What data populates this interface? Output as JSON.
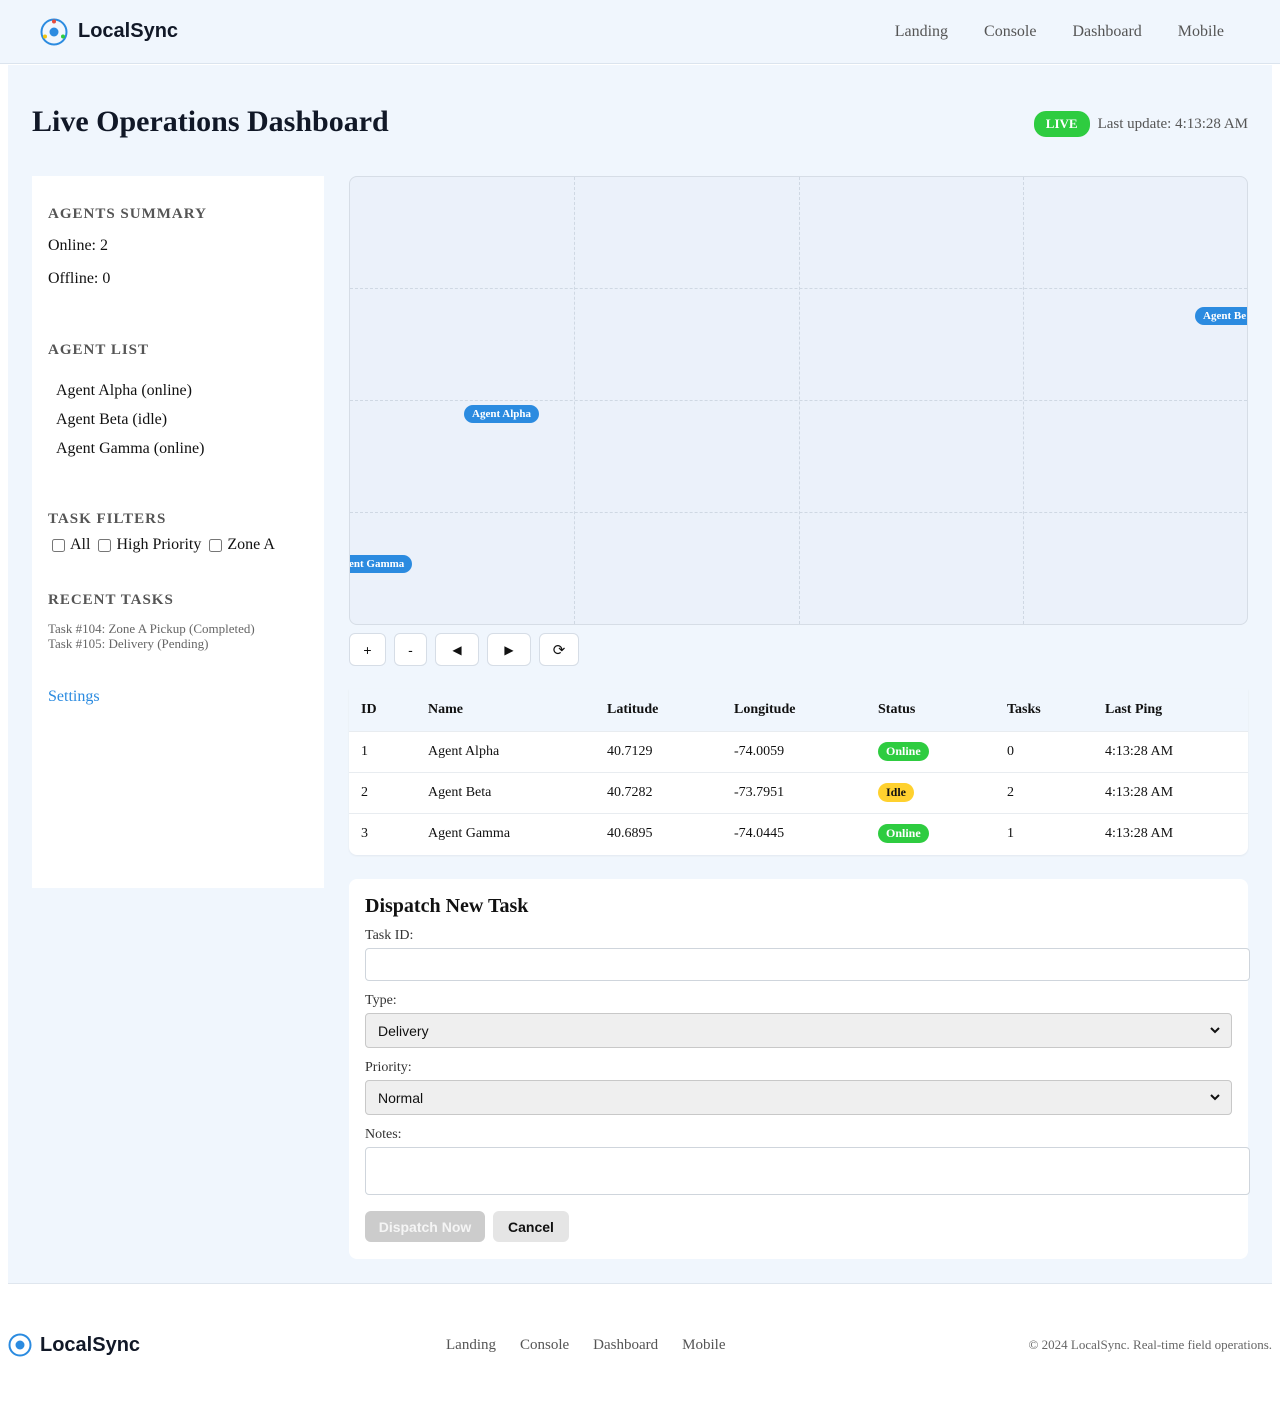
{
  "header": {
    "brand": "LocalSync",
    "nav": [
      "Landing",
      "Console",
      "Dashboard",
      "Mobile"
    ]
  },
  "page": {
    "title": "Live Operations Dashboard",
    "live_badge": "LIVE",
    "last_update": "Last update: 4:13:28 AM"
  },
  "sidebar": {
    "agents_summary_title": "AGENTS SUMMARY",
    "online": "Online: 2",
    "offline": "Offline: 0",
    "agent_list_title": "AGENT LIST",
    "agents": [
      "Agent Alpha (online)",
      "Agent Beta (idle)",
      "Agent Gamma (online)"
    ],
    "task_filters_title": "TASK FILTERS",
    "filters": [
      "All",
      "High Priority",
      "Zone A"
    ],
    "recent_tasks_title": "RECENT TASKS",
    "recent_tasks": [
      "Task #104: Zone A Pickup (Completed)",
      "Task #105: Delivery (Pending)"
    ],
    "settings": "Settings"
  },
  "map": {
    "markers": [
      "Agent Alpha",
      "Agent Be",
      "ent Gamma"
    ],
    "controls": [
      "+",
      "-",
      "◀",
      "▶",
      "⟳"
    ]
  },
  "table": {
    "headers": [
      "ID",
      "Name",
      "Latitude",
      "Longitude",
      "Status",
      "Tasks",
      "Last Ping"
    ],
    "rows": [
      [
        "1",
        "Agent Alpha",
        "40.7129",
        "-74.0059",
        "Online",
        "0",
        "4:13:28 AM"
      ],
      [
        "2",
        "Agent Beta",
        "40.7282",
        "-73.7951",
        "Idle",
        "2",
        "4:13:28 AM"
      ],
      [
        "3",
        "Agent Gamma",
        "40.6895",
        "-74.0445",
        "Online",
        "1",
        "4:13:28 AM"
      ]
    ]
  },
  "form": {
    "title": "Dispatch New Task",
    "task_id_label": "Task ID:",
    "type_label": "Type:",
    "type_value": "Delivery",
    "priority_label": "Priority:",
    "priority_value": "Normal",
    "notes_label": "Notes:",
    "dispatch_button": "Dispatch Now",
    "cancel_button": "Cancel"
  },
  "footer": {
    "brand": "LocalSync",
    "nav": [
      "Landing",
      "Console",
      "Dashboard",
      "Mobile"
    ],
    "copyright": "© 2024 LocalSync. Real-time field operations."
  },
  "colors": {
    "accent": "#2b8be0",
    "live": "#2ecc40",
    "idle": "#ffd12e"
  }
}
